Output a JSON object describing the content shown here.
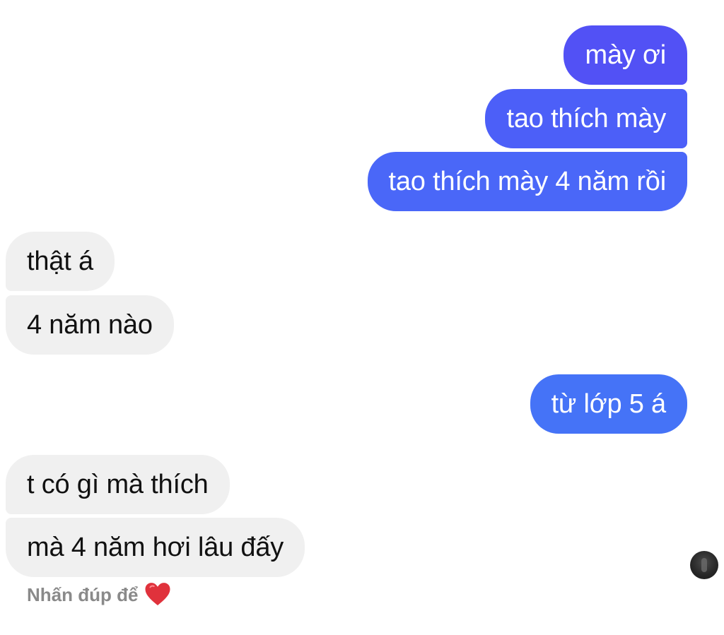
{
  "messages": [
    {
      "id": "m1",
      "direction": "outgoing",
      "text": "mày ơi"
    },
    {
      "id": "m2",
      "direction": "outgoing",
      "text": "tao thích mày"
    },
    {
      "id": "m3",
      "direction": "outgoing",
      "text": "tao thích mày 4 năm rồi"
    },
    {
      "id": "m4",
      "direction": "incoming",
      "text": "thật á"
    },
    {
      "id": "m5",
      "direction": "incoming",
      "text": "4 năm nào"
    },
    {
      "id": "m6",
      "direction": "outgoing",
      "text": "từ lớp 5 á"
    },
    {
      "id": "m7",
      "direction": "incoming",
      "text": "t có gì mà thích"
    },
    {
      "id": "m8",
      "direction": "incoming",
      "text": "mà 4 năm hơi lâu đấy"
    }
  ],
  "reaction_hint": {
    "text": "Nhấn đúp để",
    "icon": "heart-icon"
  },
  "read_receipt": {
    "icon": "avatar"
  },
  "colors": {
    "outgoing_top": "#5251f5",
    "outgoing_bottom": "#4573f7",
    "incoming_bg": "#f0f0f0",
    "heart": "#e0323c",
    "hint_text": "#8a8a8a"
  }
}
